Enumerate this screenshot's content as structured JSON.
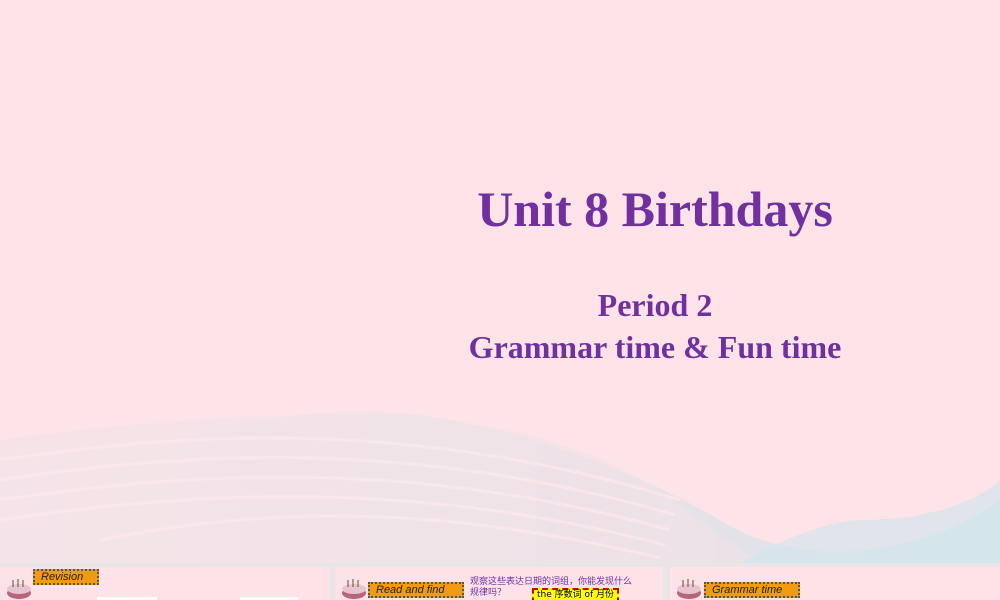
{
  "slide": {
    "title": "Unit 8 Birthdays",
    "period": "Period 2",
    "subtitle": "Grammar time & Fun time"
  },
  "thumbnails": [
    {
      "tag": "Revision"
    },
    {
      "tag": "Read and find",
      "note": "观察这些表达日期的词组，你能发现什么规律吗？",
      "note_line1": "观察这些表达日期的词组，你能发现什么",
      "note_line2": "规律吗？",
      "box": "the  序数词  of  月份"
    },
    {
      "tag": "Grammar time"
    }
  ],
  "colors": {
    "title": "#7030a0",
    "background": "#fee3e8",
    "tag": "#f39a12"
  }
}
